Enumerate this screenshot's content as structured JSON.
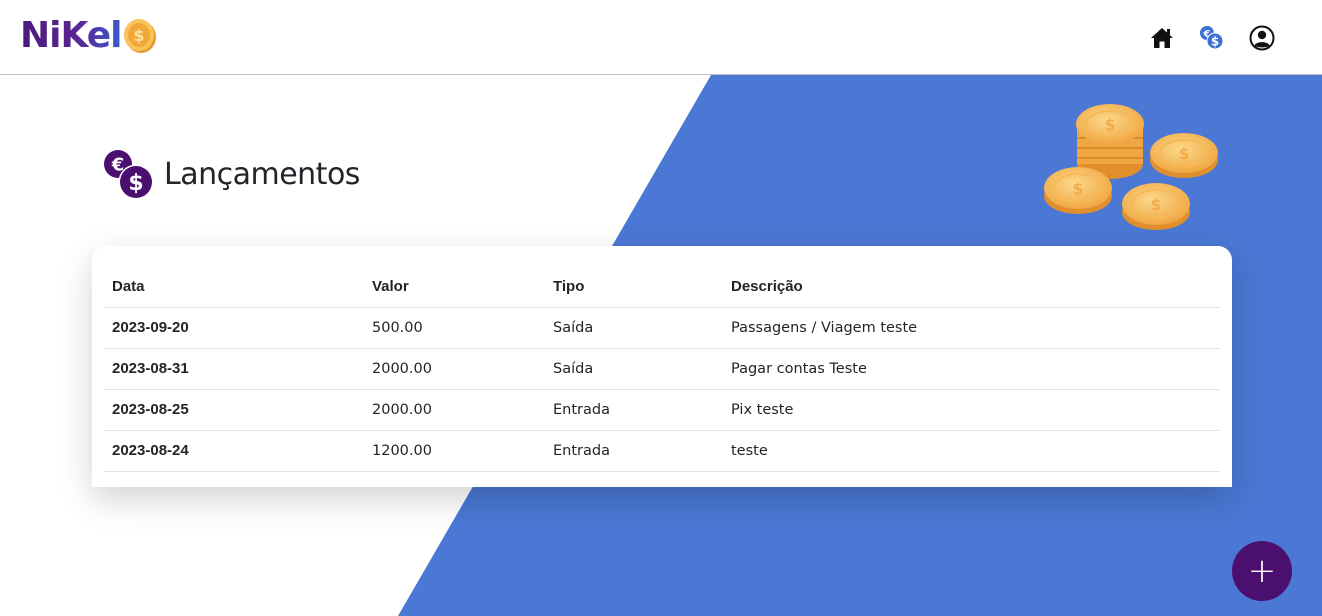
{
  "brand": {
    "name": "NiKel"
  },
  "nav": {
    "items": [
      {
        "name": "home-icon"
      },
      {
        "name": "transactions-icon"
      },
      {
        "name": "profile-icon"
      }
    ]
  },
  "page": {
    "title": "Lançamentos",
    "title_icon": "currency-exchange-icon"
  },
  "table": {
    "headers": {
      "date": "Data",
      "value": "Valor",
      "type": "Tipo",
      "description": "Descrição"
    },
    "rows": [
      {
        "date": "2023-09-20",
        "value": "500.00",
        "type": "Saída",
        "description": "Passagens / Viagem teste"
      },
      {
        "date": "2023-08-31",
        "value": "2000.00",
        "type": "Saída",
        "description": "Pagar contas Teste"
      },
      {
        "date": "2023-08-25",
        "value": "2000.00",
        "type": "Entrada",
        "description": "Pix teste"
      },
      {
        "date": "2023-08-24",
        "value": "1200.00",
        "type": "Entrada",
        "description": "teste"
      }
    ]
  },
  "fab": {
    "label": "+"
  },
  "colors": {
    "accent_blue": "#4a78d4",
    "brand_purple": "#4a0f6f",
    "coin_gold": "#f5b546"
  }
}
